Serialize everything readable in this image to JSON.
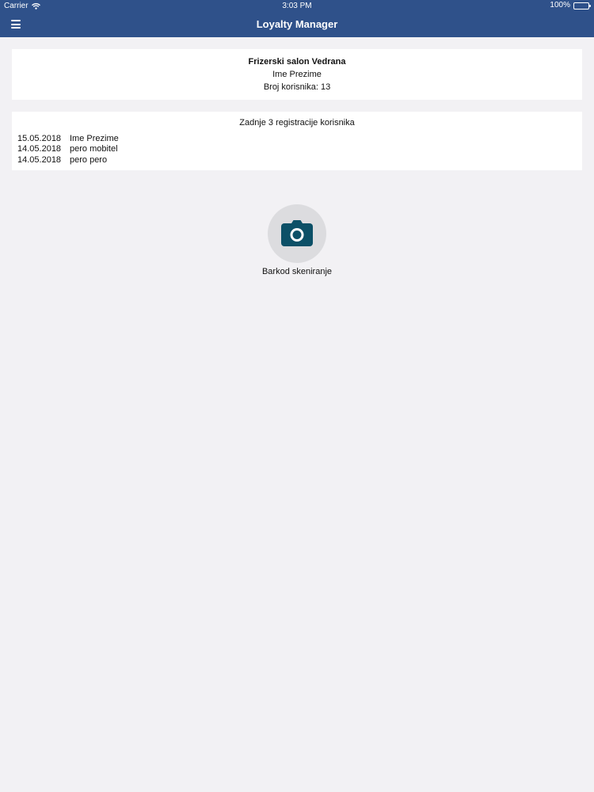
{
  "status_bar": {
    "carrier": "Carrier",
    "time": "3:03 PM",
    "battery": "100%"
  },
  "nav": {
    "title": "Loyalty Manager",
    "menu_icon": "hamburger-menu-icon"
  },
  "info": {
    "salon_name": "Frizerski salon Vedrana",
    "user_name": "Ime Prezime",
    "user_count_label": "Broj korisnika: 13"
  },
  "registrations": {
    "title": "Zadnje 3 registracije korisnika",
    "items": [
      {
        "date": "15.05.2018",
        "name": "Ime Prezime"
      },
      {
        "date": "14.05.2018",
        "name": "pero mobitel"
      },
      {
        "date": "14.05.2018",
        "name": "pero pero"
      }
    ]
  },
  "scan": {
    "icon": "camera-icon",
    "label": "Barkod skeniranje"
  },
  "colors": {
    "nav_bg": "#2f518a",
    "page_bg": "#f2f1f4",
    "camera": "#0c5067",
    "scan_circle": "#dcdcdf"
  }
}
